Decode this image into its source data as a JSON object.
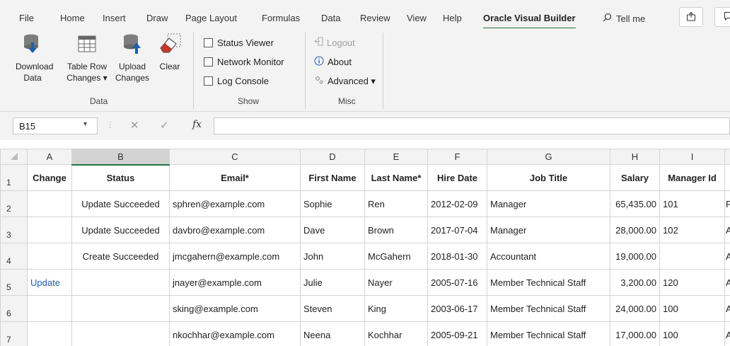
{
  "tabs": [
    "File",
    "Home",
    "Insert",
    "Draw",
    "Page Layout",
    "Formulas",
    "Data",
    "Review",
    "View",
    "Help",
    "Oracle Visual Builder"
  ],
  "tell_me": "Tell me",
  "ribbon": {
    "data_group": {
      "label": "Data",
      "download": [
        "Download",
        "Data"
      ],
      "table_row": [
        "Table Row",
        "Changes ▾"
      ],
      "upload": [
        "Upload",
        "Changes"
      ],
      "clear": "Clear"
    },
    "show_group": {
      "label": "Show",
      "status_viewer": "Status Viewer",
      "network_monitor": "Network Monitor",
      "log_console": "Log Console"
    },
    "misc_group": {
      "label": "Misc",
      "logout": "Logout",
      "about": "About",
      "advanced": "Advanced ▾"
    }
  },
  "formula_bar": {
    "name_box": "B15",
    "fx": "fx",
    "value": ""
  },
  "columns": [
    "A",
    "B",
    "C",
    "D",
    "E",
    "F",
    "G",
    "H",
    "I"
  ],
  "selected_column": "B",
  "headers": [
    "Change",
    "Status",
    "Email*",
    "First Name",
    "Last Name*",
    "Hire Date",
    "Job Title",
    "Salary",
    "Manager Id"
  ],
  "rows": [
    {
      "n": "2",
      "change": "",
      "status": "Update Succeeded",
      "email": "sphren@example.com",
      "first": "Sophie",
      "last": "Ren",
      "hire": "2012-02-09",
      "job": "Manager",
      "salary": "65,435.00",
      "manager": "101",
      "extra": "F"
    },
    {
      "n": "3",
      "change": "",
      "status": "Update Succeeded",
      "email": "davbro@example.com",
      "first": "Dave",
      "last": "Brown",
      "hire": "2017-07-04",
      "job": "Manager",
      "salary": "28,000.00",
      "manager": "102",
      "extra": "A"
    },
    {
      "n": "4",
      "change": "",
      "status": "Create Succeeded",
      "email": "jmcgahern@example.com",
      "first": "John",
      "last": "McGahern",
      "hire": "2018-01-30",
      "job": "Accountant",
      "salary": "19,000.00",
      "manager": "",
      "extra": "A"
    },
    {
      "n": "5",
      "change": "Update",
      "status": "",
      "email": "jnayer@example.com",
      "first": "Julie",
      "last": "Nayer",
      "hire": "2005-07-16",
      "job": "Member Technical Staff",
      "salary": "3,200.00",
      "manager": "120",
      "extra": "A"
    },
    {
      "n": "6",
      "change": "",
      "status": "",
      "email": "sking@example.com",
      "first": "Steven",
      "last": "King",
      "hire": "2003-06-17",
      "job": "Member Technical Staff",
      "salary": "24,000.00",
      "manager": "100",
      "extra": "A"
    },
    {
      "n": "7",
      "change": "",
      "status": "",
      "email": "nkochhar@example.com",
      "first": "Neena",
      "last": "Kochhar",
      "hire": "2005-09-21",
      "job": "Member Technical Staff",
      "salary": "17,000.00",
      "manager": "100",
      "extra": "A"
    }
  ],
  "header_row_number": "1",
  "colors": {
    "accent": "#217346",
    "link": "#1f5fa8"
  }
}
